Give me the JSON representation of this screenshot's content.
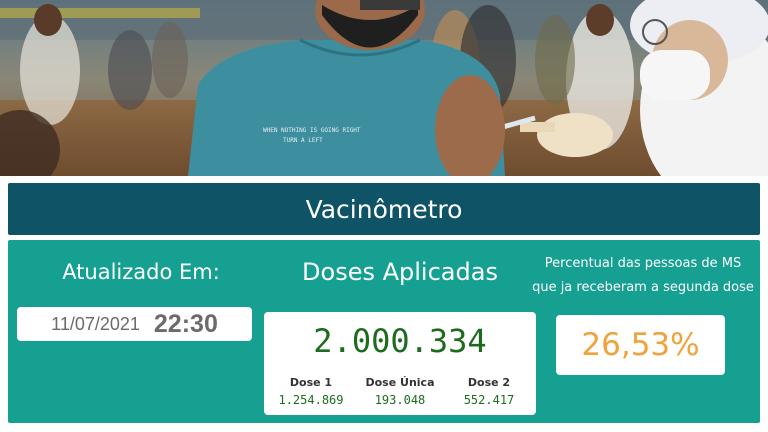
{
  "hero": {
    "photo_description_icon": "vaccination-photo",
    "shirt_text": [
      "WHEN NOTHING IS GOING RIGHT",
      "TURN A LEFT"
    ]
  },
  "title": "Vacinômetro",
  "updated": {
    "label": "Atualizado Em:",
    "date": "11/07/2021",
    "time": "22:30"
  },
  "doses": {
    "label": "Doses Aplicadas",
    "total": "2.000.334",
    "breakdown": [
      {
        "label": "Dose 1",
        "value": "1.254.869"
      },
      {
        "label": "Dose Única",
        "value": "193.048"
      },
      {
        "label": "Dose 2",
        "value": "552.417"
      }
    ]
  },
  "percent": {
    "label_line1": "Percentual das pessoas de MS",
    "label_line2": "que ja receberam a segunda dose",
    "value": "26,53%"
  },
  "colors": {
    "title_bar": "#0f5466",
    "panel": "#16a091",
    "dose_green": "#1e6b1e",
    "percent_orange": "#f2a23a"
  }
}
